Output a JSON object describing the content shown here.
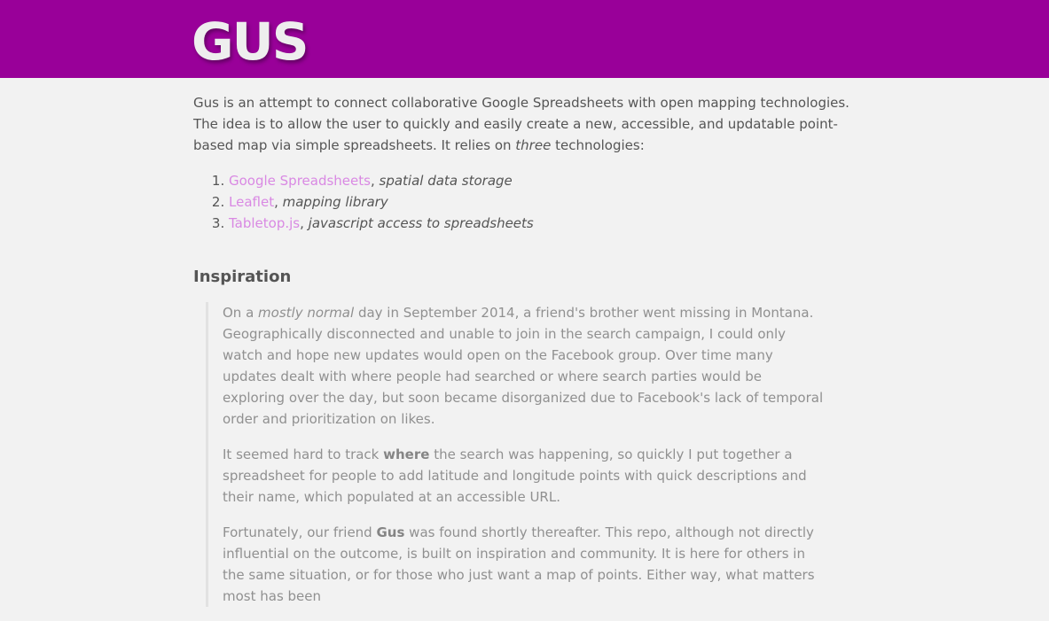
{
  "header": {
    "title": "GUS",
    "bg_color": "#990099"
  },
  "intro": {
    "text_before_em": "Gus is an attempt to connect collaborative Google Spreadsheets with open mapping technologies. The idea is to allow the user to quickly and easily create a new, accessible, and updatable point-based map via simple spreadsheets. It relies on ",
    "em": "three",
    "text_after_em": " technologies:"
  },
  "technologies": [
    {
      "link": "Google Spreadsheets",
      "desc": "spatial data storage"
    },
    {
      "link": "Leaflet",
      "desc": "mapping library"
    },
    {
      "link": "Tabletop.js",
      "desc": "javascript access to spreadsheets"
    }
  ],
  "inspiration": {
    "heading": "Inspiration",
    "p1": {
      "a": "On a ",
      "em": "mostly normal",
      "b": " day in September 2014, a friend's brother went missing in Montana. Geographically disconnected and unable to join in the search campaign, I could only watch and hope new updates would open on the Facebook group. Over time many updates dealt with where people had searched or where search parties would be exploring over the day, but soon became disorganized due to Facebook's lack of temporal order and prioritization on likes."
    },
    "p2": {
      "a": "It seemed hard to track ",
      "strong": "where",
      "b": " the search was happening, so quickly I put together a spreadsheet for people to add latitude and longitude points with quick descriptions and their name, which populated at an accessible URL."
    },
    "p3": {
      "a": "Fortunately, our friend ",
      "strong": "Gus",
      "b": " was found shortly thereafter. This repo, although not directly influential on the outcome, is built on inspiration and community. It is here for others in the same situation, or for those who just want a map of points. Either way, what matters most has been"
    }
  },
  "colors": {
    "link": "#d989e3",
    "text": "#555555",
    "quote_text": "#909090",
    "background": "#f2f2f2"
  }
}
